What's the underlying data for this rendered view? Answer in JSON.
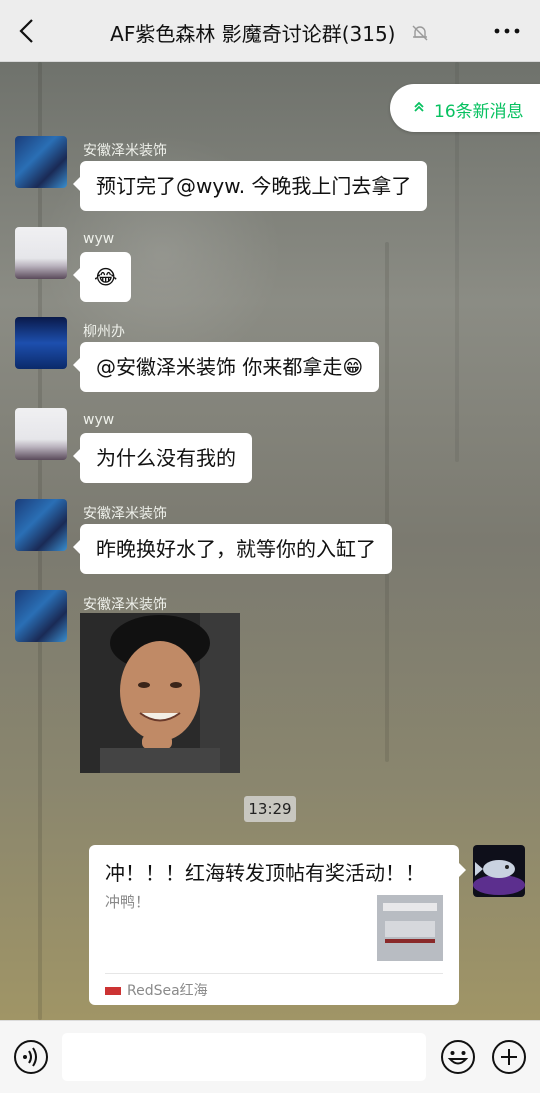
{
  "header": {
    "title": "AF紫色森林 影魔奇讨论群(315)"
  },
  "chat": {
    "new_messages": "16条新消息",
    "messages": [
      {
        "sender": "安徽泽米装饰",
        "text": "预订完了@wyw.  今晚我上门去拿了"
      },
      {
        "sender": "wyw",
        "text": "😂"
      },
      {
        "sender": "柳州办",
        "text": "@安徽泽米装饰  你来都拿走😁"
      },
      {
        "sender": "wyw",
        "text": "为什么没有我的"
      },
      {
        "sender": "安徽泽米装饰",
        "text": "昨晚换好水了，就等你的入缸了"
      },
      {
        "sender": "安徽泽米装饰",
        "text": ""
      }
    ],
    "timestamp": "13:29",
    "link_card": {
      "title": "冲！！！红海转发顶帖有奖活动！！",
      "description": "冲鸭！",
      "source": "RedSea红海"
    }
  },
  "input": {
    "value": ""
  },
  "colors": {
    "accent": "#07c160"
  }
}
